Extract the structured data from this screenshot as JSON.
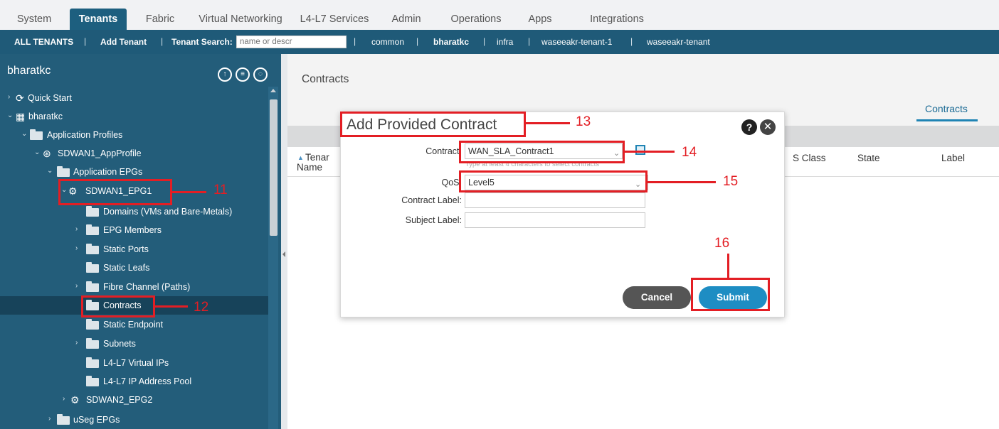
{
  "top_tabs": [
    "System",
    "Tenants",
    "Fabric",
    "Virtual Networking",
    "L4-L7 Services",
    "Admin",
    "Operations",
    "Apps",
    "Integrations"
  ],
  "tenant_bar": {
    "all_tenants": "ALL TENANTS",
    "separator": "|",
    "add_tenant": "Add Tenant",
    "tenant_search_label": "Tenant Search:",
    "search_placeholder": "name or descr",
    "tenants": [
      "common",
      "bharatkc",
      "infra",
      "waseeakr-tenant-1",
      "waseeakr-tenant"
    ]
  },
  "nav": {
    "title": "bharatkc",
    "tree": [
      {
        "label": "Quick Start"
      },
      {
        "label": "bharatkc"
      },
      {
        "label": "Application Profiles"
      },
      {
        "label": "SDWAN1_AppProfile"
      },
      {
        "label": "Application EPGs"
      },
      {
        "label": "SDWAN1_EPG1"
      },
      {
        "label": "Domains (VMs and Bare-Metals)"
      },
      {
        "label": "EPG Members"
      },
      {
        "label": "Static Ports"
      },
      {
        "label": "Static Leafs"
      },
      {
        "label": "Fibre Channel (Paths)"
      },
      {
        "label": "Contracts"
      },
      {
        "label": "Static Endpoint"
      },
      {
        "label": "Subnets"
      },
      {
        "label": "L4-L7 Virtual IPs"
      },
      {
        "label": "L4-L7 IP Address Pool"
      },
      {
        "label": "SDWAN2_EPG2"
      },
      {
        "label": "uSeg EPGs"
      }
    ]
  },
  "main": {
    "title": "Contracts",
    "active_tab": "Contracts",
    "columns": {
      "tenant": "Tenar",
      "name": "Name",
      "qos_class": "S Class",
      "state": "State",
      "label": "Label"
    }
  },
  "dialog": {
    "title": "Add Provided Contract",
    "contract_label": "Contract:",
    "contract_value": "WAN_SLA_Contract1",
    "contract_hint": "Type at least 4 characters to select contracts",
    "qos_label": "QoS:",
    "qos_value": "Level5",
    "contract_label_label": "Contract Label:",
    "subject_label_label": "Subject Label:",
    "cancel": "Cancel",
    "submit": "Submit"
  },
  "annotations": [
    "11",
    "12",
    "13",
    "14",
    "15",
    "16"
  ],
  "colors": {
    "accent": "#1f5a78",
    "nav": "#235d7a",
    "annotation": "#e31e24",
    "submit": "#1e8dc3"
  }
}
